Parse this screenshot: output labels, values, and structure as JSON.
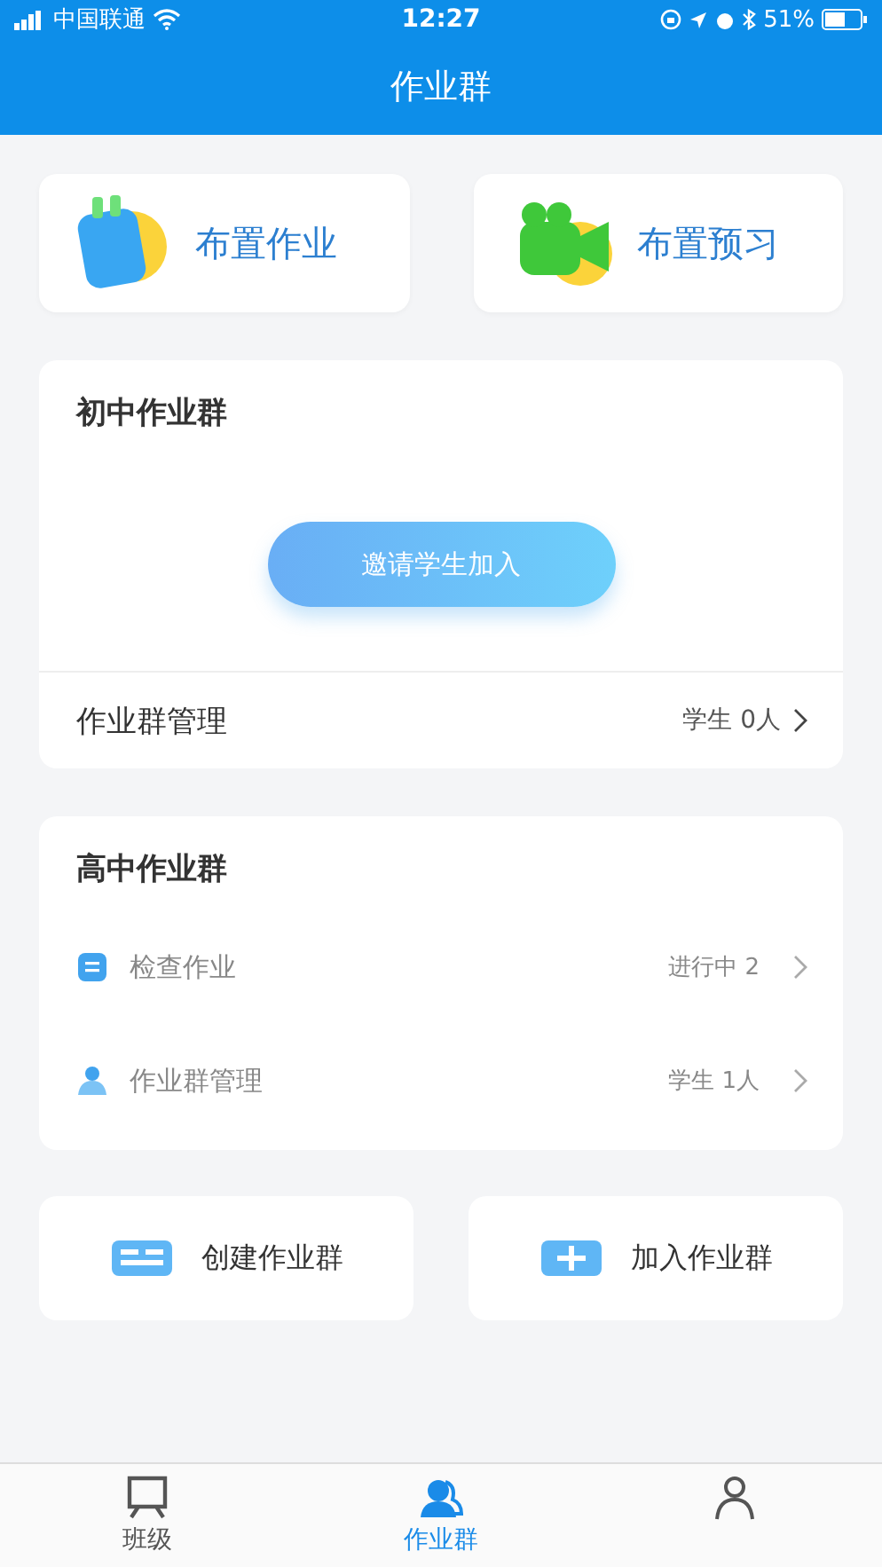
{
  "status_bar": {
    "carrier": "中国联通",
    "time": "12:27",
    "battery": "51%"
  },
  "header": {
    "title": "作业群"
  },
  "quick_actions": [
    {
      "label": "布置作业",
      "kind": "homework"
    },
    {
      "label": "布置预习",
      "kind": "preview"
    }
  ],
  "groups": [
    {
      "title": "初中作业群",
      "invite_button": "邀请学生加入",
      "rows": [
        {
          "kind": "plain",
          "label": "作业群管理",
          "value": "学生 0人"
        }
      ]
    },
    {
      "title": "高中作业群",
      "rows": [
        {
          "kind": "check",
          "label": "检查作业",
          "value": "进行中 2"
        },
        {
          "kind": "members",
          "label": "作业群管理",
          "value": "学生 1人"
        }
      ]
    }
  ],
  "bottom_actions": [
    {
      "label": "创建作业群",
      "kind": "create"
    },
    {
      "label": "加入作业群",
      "kind": "join"
    }
  ],
  "tabs": [
    {
      "label": "班级",
      "kind": "class",
      "selected": false
    },
    {
      "label": "作业群",
      "kind": "group",
      "selected": true
    },
    {
      "kind": "me",
      "selected": false
    }
  ]
}
